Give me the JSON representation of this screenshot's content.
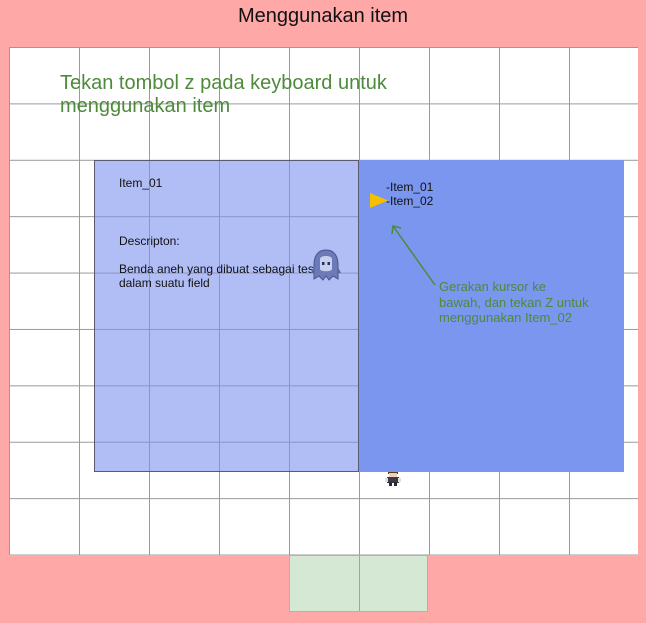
{
  "title": "Menggunakan item",
  "instruction": "Tekan tombol z pada keyboard untuk menggunakan item",
  "item_panel": {
    "selected_item": "Item_01",
    "description_label": "Descripton:",
    "description": "Benda aneh yang dibuat sebagai test dalam suatu field"
  },
  "inventory": {
    "items": [
      "-Item_01",
      "-Item_02"
    ],
    "cursor_index": 1
  },
  "hint": "Gerakan kursor ke bawah, dan tekan Z untuk menggunakan Item_02",
  "colors": {
    "background": "#ffa8a8",
    "grid_floor": "#ffffff",
    "panel_left": "#aabaf4",
    "panel_right": "#7a96ee",
    "hint_text": "#4d8a3b",
    "cursor": "#f5c000",
    "exit_tile": "#d5e8d4"
  },
  "icons": {
    "cursor": "triangle-right",
    "sprite_ghost": "hooded-character",
    "sprite_player": "player-character"
  }
}
